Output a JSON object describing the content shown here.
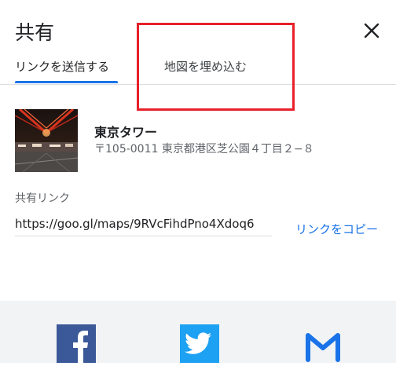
{
  "dialog": {
    "title": "共有",
    "close_icon": "close-icon",
    "tabs": [
      {
        "label": "リンクを送信する",
        "active": true
      },
      {
        "label": "地図を埋め込む",
        "active": false
      }
    ]
  },
  "place": {
    "name": "東京タワー",
    "address": "〒105-0011 東京都港区芝公園４丁目２−８",
    "thumbnail_icon": "tokyo-tower-photo"
  },
  "share": {
    "label": "共有リンク",
    "link": "https://goo.gl/maps/9RVcFihdPno4Xdoq6",
    "copy_label": "リンクをコピー"
  },
  "social": [
    {
      "name": "facebook-icon",
      "color": "#3b5998"
    },
    {
      "name": "twitter-icon",
      "color": "#1da1f2"
    },
    {
      "name": "gmail-icon",
      "color": "#1a73e8"
    }
  ],
  "colors": {
    "accent": "#1a73e8",
    "highlight": "#e8202a"
  }
}
